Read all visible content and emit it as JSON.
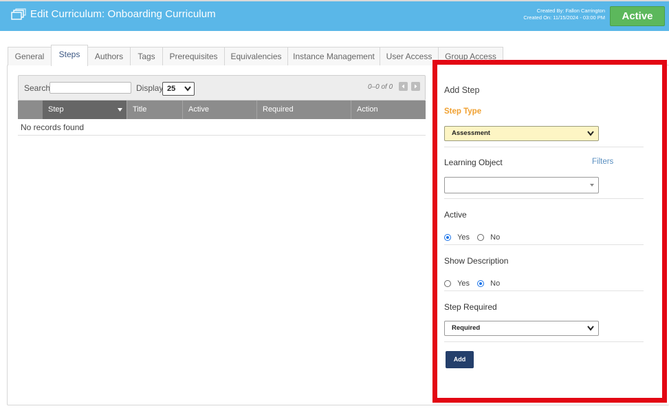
{
  "header": {
    "title": "Edit Curriculum: Onboarding Curriculum",
    "created_by": "Created By: Fallon Carrington",
    "created_on": "Created On: 11/15/2024 - 03:00 PM",
    "status_label": "Active",
    "status_color": "#5cb85c",
    "background_color": "#5ab7e8"
  },
  "tabs": [
    {
      "label": "General",
      "active": false
    },
    {
      "label": "Steps",
      "active": true
    },
    {
      "label": "Authors",
      "active": false
    },
    {
      "label": "Tags",
      "active": false
    },
    {
      "label": "Prerequisites",
      "active": false
    },
    {
      "label": "Equivalencies",
      "active": false
    },
    {
      "label": "Instance Management",
      "active": false
    },
    {
      "label": "User Access",
      "active": false
    },
    {
      "label": "Group Access",
      "active": false
    }
  ],
  "grid": {
    "search_label": "Search",
    "search_value": "",
    "display_label": "Display",
    "display_value": "25",
    "count_text": "0–0 of 0",
    "columns": [
      "Step",
      "Title",
      "Active",
      "Required",
      "Action"
    ],
    "sorted_column": "Step",
    "empty_message": "No records found"
  },
  "add_step": {
    "heading": "Add Step",
    "step_type_label": "Step Type",
    "step_type_value": "Assessment",
    "learning_object_label": "Learning Object",
    "filters_label": "Filters",
    "learning_object_value": "",
    "active_label": "Active",
    "active_options": [
      "Yes",
      "No"
    ],
    "active_selected": "Yes",
    "show_description_label": "Show Description",
    "show_description_options": [
      "Yes",
      "No"
    ],
    "show_description_selected": "No",
    "step_required_label": "Step Required",
    "step_required_value": "Required",
    "add_button_label": "Add",
    "highlight_color": "#e30613"
  }
}
